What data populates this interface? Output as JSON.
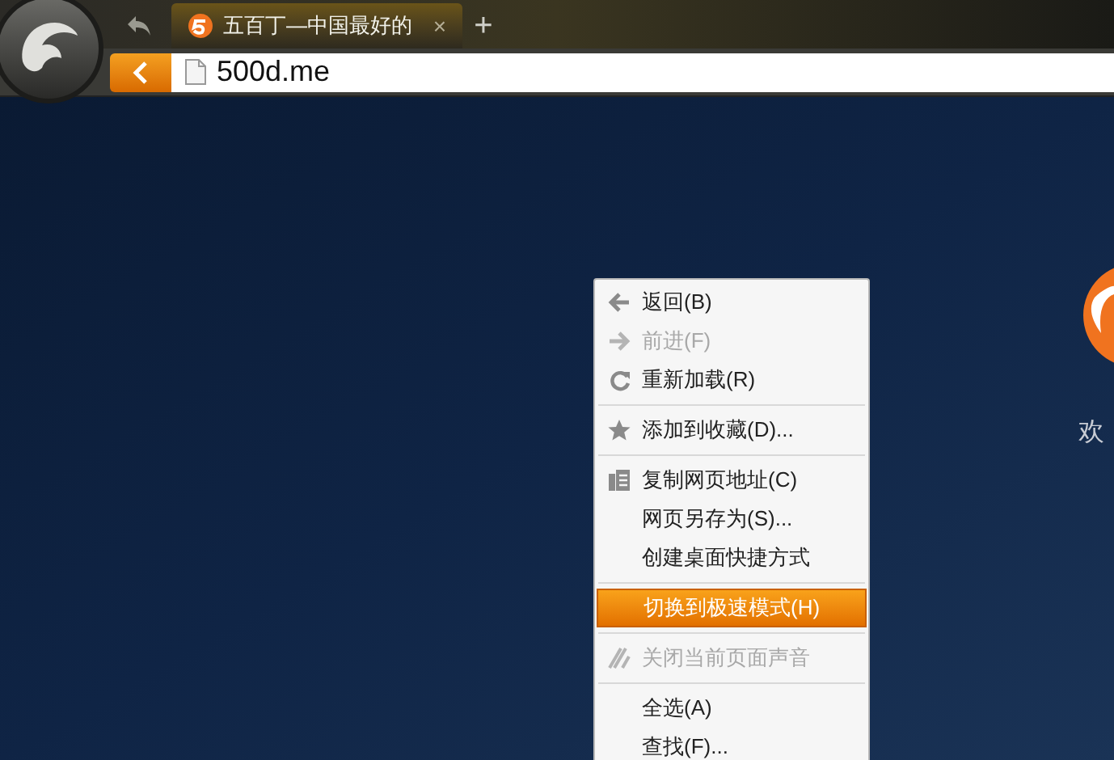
{
  "tab": {
    "title": "五百丁—中国最好的",
    "close": "×",
    "selected": true
  },
  "new_tab": "+",
  "address_bar": {
    "value": "500d.me"
  },
  "context_menu": [
    {
      "kind": "item",
      "label": "返回(B)",
      "disabled": false,
      "selected": false
    },
    {
      "kind": "item",
      "label": "前进(F)",
      "disabled": true,
      "selected": false
    },
    {
      "kind": "item",
      "label": "重新加载(R)",
      "disabled": false,
      "selected": false
    },
    {
      "kind": "separator"
    },
    {
      "kind": "item",
      "label": "添加到收藏(D)...",
      "disabled": false,
      "selected": false
    },
    {
      "kind": "separator"
    },
    {
      "kind": "item",
      "label": "复制网页地址(C)",
      "disabled": false,
      "selected": false
    },
    {
      "kind": "item",
      "label": "网页另存为(S)...",
      "disabled": false,
      "selected": false
    },
    {
      "kind": "item",
      "label": "创建桌面快捷方式",
      "disabled": false,
      "selected": false
    },
    {
      "kind": "separator"
    },
    {
      "kind": "item",
      "label": "切换到极速模式(H)",
      "disabled": false,
      "selected": true
    },
    {
      "kind": "separator"
    },
    {
      "kind": "item",
      "label": "关闭当前页面声音",
      "disabled": true,
      "selected": false
    },
    {
      "kind": "separator"
    },
    {
      "kind": "item",
      "label": "全选(A)",
      "disabled": false,
      "selected": false
    },
    {
      "kind": "item",
      "label": "查找(F)...",
      "disabled": false,
      "selected": false
    }
  ],
  "page": {
    "welcome": "欢"
  }
}
